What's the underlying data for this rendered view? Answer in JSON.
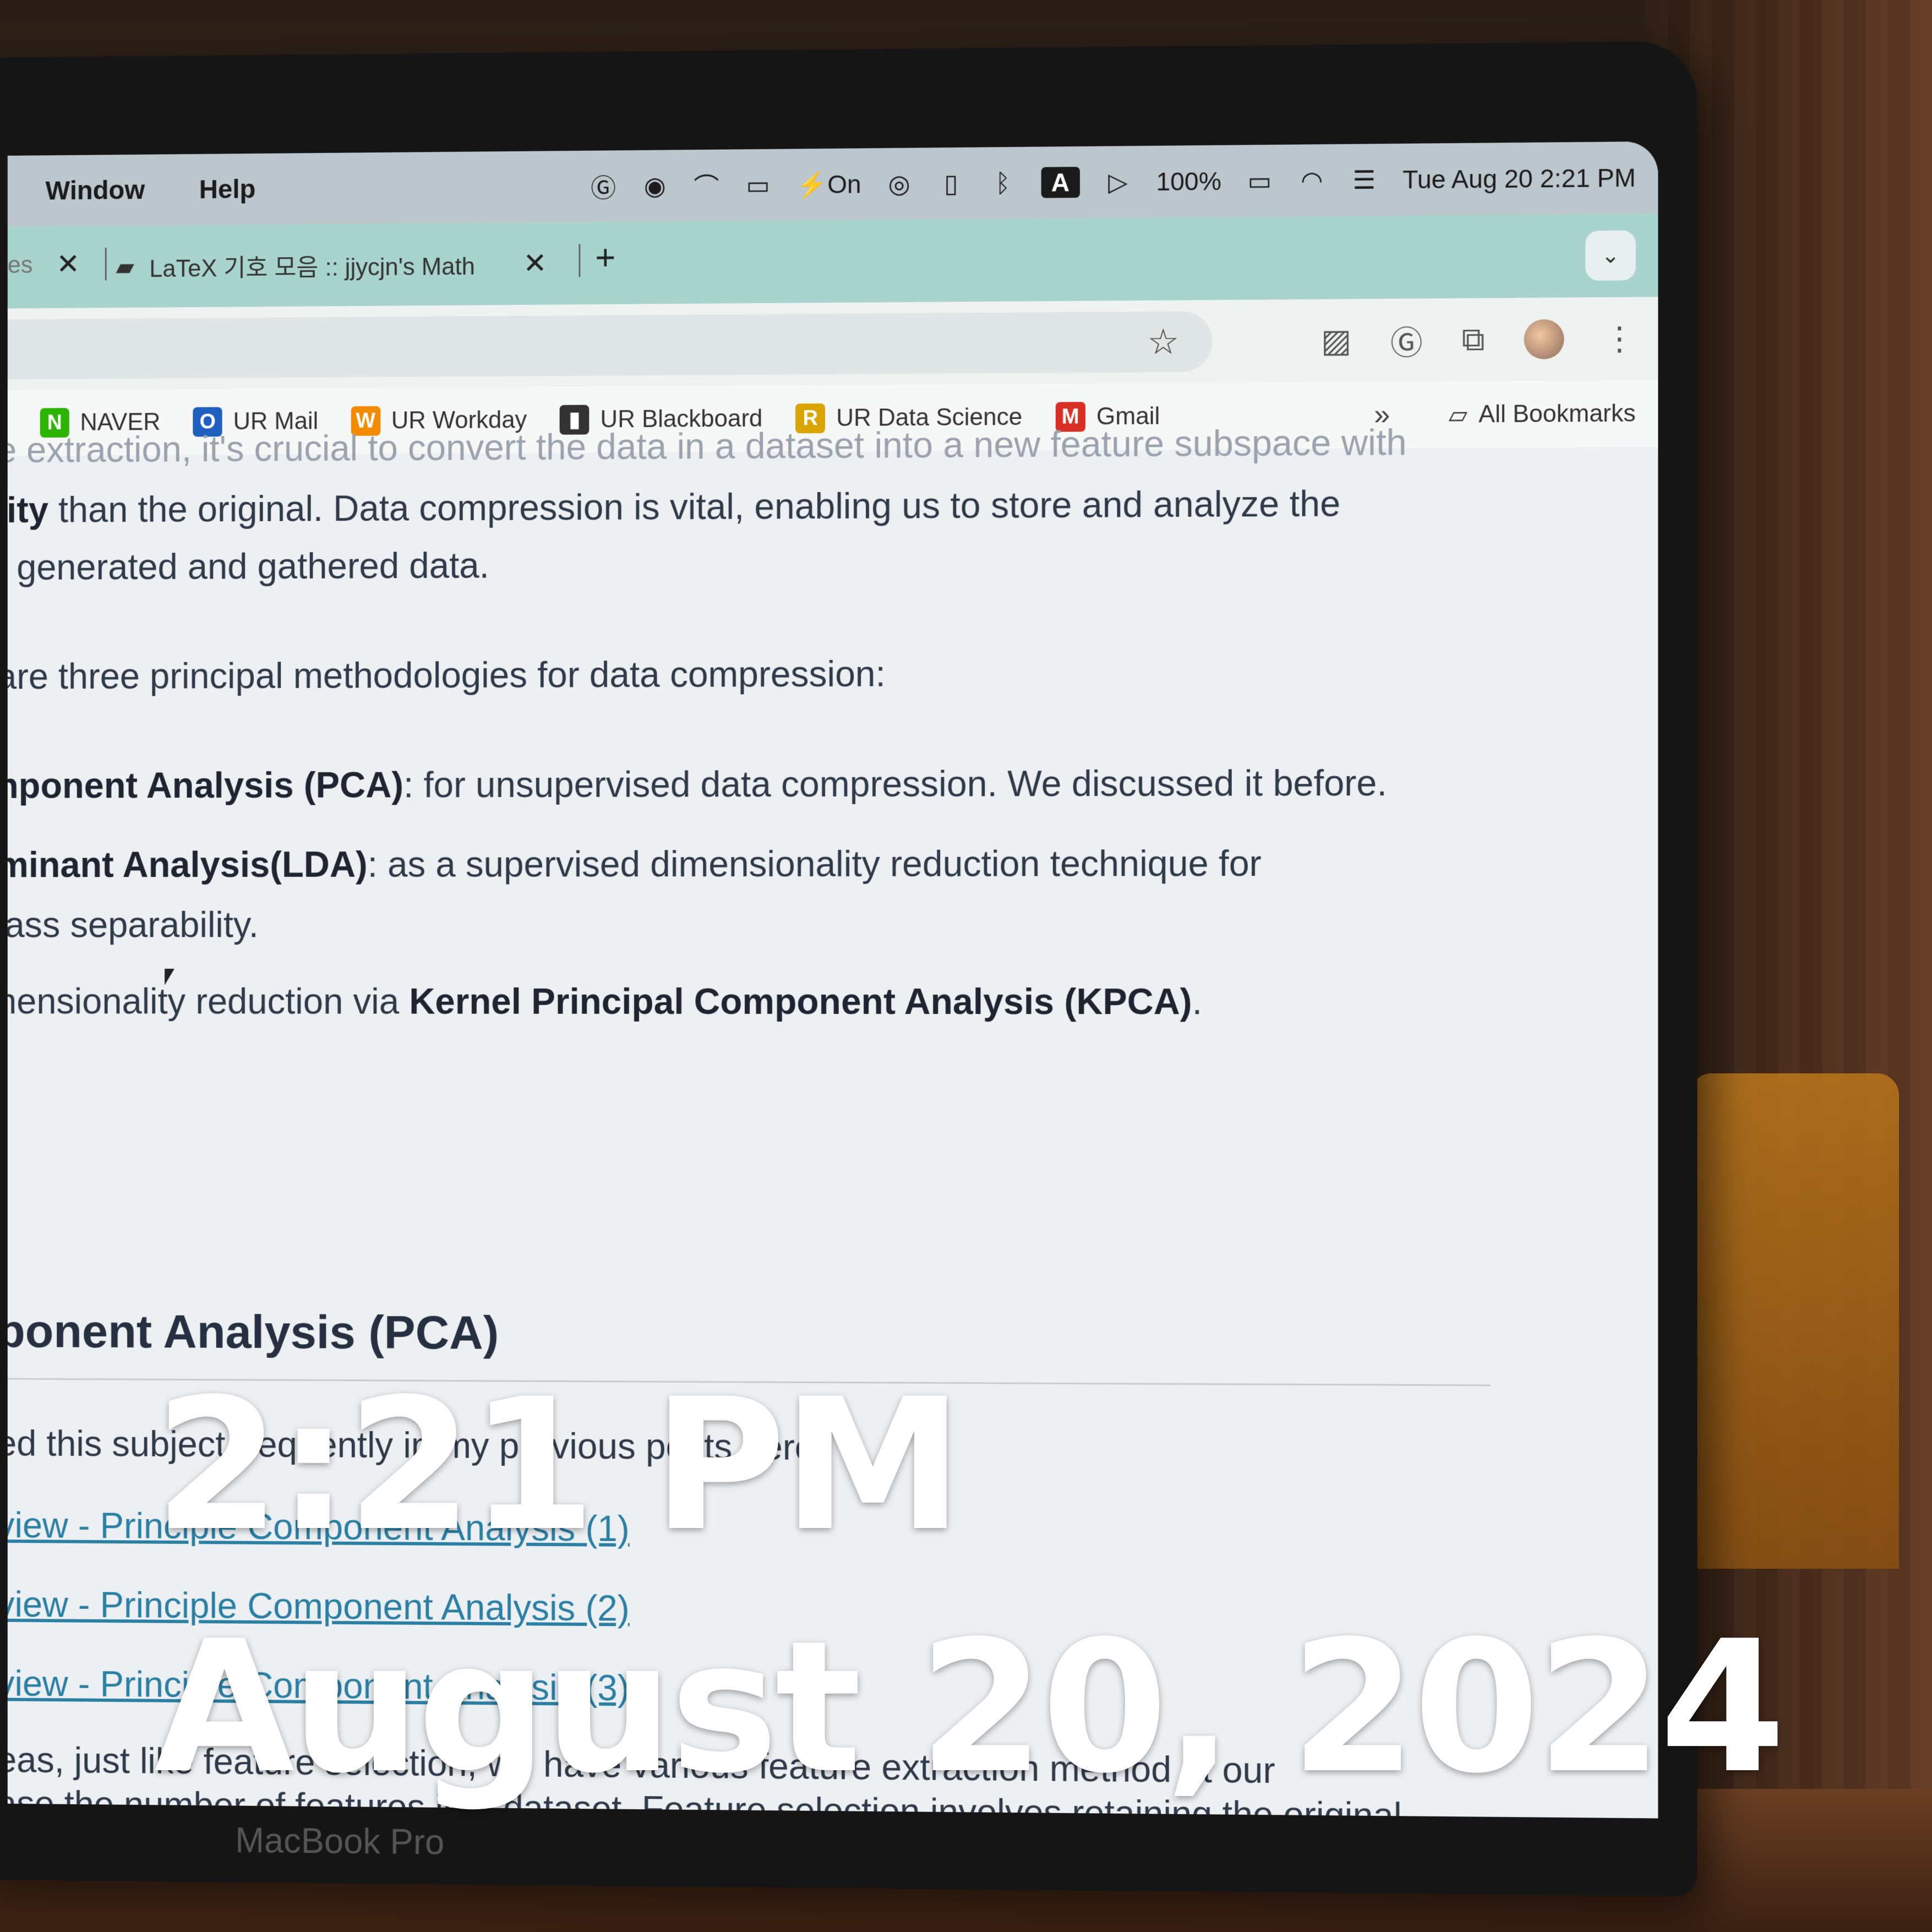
{
  "menubar": {
    "items": [
      "Window",
      "Help"
    ],
    "status": {
      "focus": "On",
      "keyboard": "A",
      "battery": "100%",
      "datetime": "Tue Aug 20  2:21 PM"
    }
  },
  "tabs": {
    "previous_label": "es",
    "active_label": "LaTeX 기호 모음 :: jjycjn's Math",
    "new_tab": "+"
  },
  "bookmarks": {
    "items": [
      {
        "label": "NAVER",
        "icon": "N",
        "color": "#2db400"
      },
      {
        "label": "UR Mail",
        "icon": "O",
        "color": "#1f5fbf"
      },
      {
        "label": "UR Workday",
        "icon": "W",
        "color": "#f38b00"
      },
      {
        "label": "UR Blackboard",
        "icon": "▮",
        "color": "#333333"
      },
      {
        "label": "UR Data Science",
        "icon": "R",
        "color": "#d9a400"
      },
      {
        "label": "Gmail",
        "icon": "M",
        "color": "#d93025"
      }
    ],
    "more": "»",
    "all": "All Bookmarks"
  },
  "content": {
    "line_partial_top": "e extraction, it's crucial to convert the data in a dataset into a new feature subspace with",
    "p1_bold": "lity",
    "p1_rest": " than the original. Data compression is vital, enabling us to store and analyze the",
    "p1_line2": "f generated and gathered data.",
    "p2": " are three principal methodologies for data compression:",
    "li1_bold": "nponent Analysis (PCA)",
    "li1_rest": ": for unsupervised data compression. We discussed it before.",
    "li2_bold": "minant Analysis(LDA)",
    "li2_rest": ": as a supervised dimensionality reduction technique for",
    "li2_line2": "lass separability.",
    "li3_pre": "nensionality reduction via ",
    "li3_bold": "Kernel Principal Component Analysis (KPCA)",
    "li3_post": ".",
    "heading": "ponent Analysis (PCA)",
    "p3": "ed this subject frequently in my previous posts here:",
    "links": [
      "view - Principle Component Analysis (1)",
      "view - Principle Component Analysis (2)",
      "view - Principle Component Analysis (3)"
    ],
    "p4_line1": "eas, just like feature selection, we have various feature extraction method at our",
    "p4_line2": "ase the number of features in a dataset. Feature selection involves retaining the original"
  },
  "overlay": {
    "time": "2:21 PM",
    "date": "August 20, 2024"
  },
  "device_label": "MacBook Pro"
}
